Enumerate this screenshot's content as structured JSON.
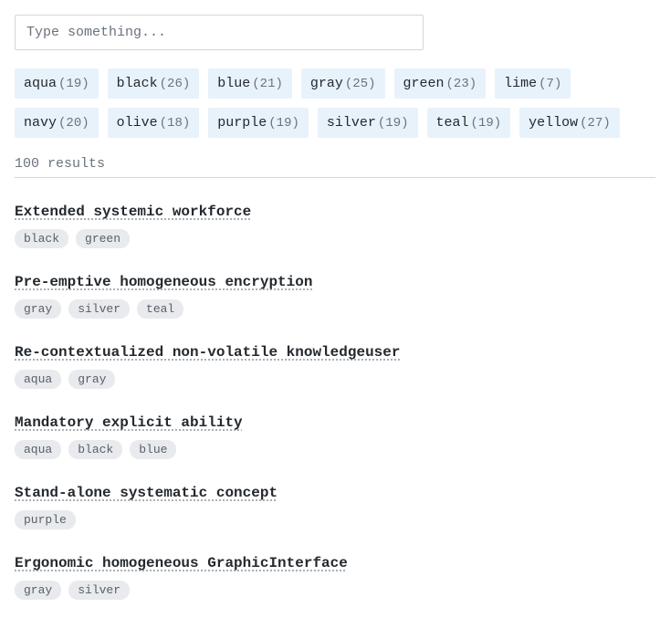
{
  "search": {
    "placeholder": "Type something..."
  },
  "filters": [
    {
      "name": "aqua",
      "count": 19
    },
    {
      "name": "black",
      "count": 26
    },
    {
      "name": "blue",
      "count": 21
    },
    {
      "name": "gray",
      "count": 25
    },
    {
      "name": "green",
      "count": 23
    },
    {
      "name": "lime",
      "count": 7
    },
    {
      "name": "navy",
      "count": 20
    },
    {
      "name": "olive",
      "count": 18
    },
    {
      "name": "purple",
      "count": 19
    },
    {
      "name": "silver",
      "count": 19
    },
    {
      "name": "teal",
      "count": 19
    },
    {
      "name": "yellow",
      "count": 27
    }
  ],
  "results_label": "100 results",
  "results": [
    {
      "title": "Extended systemic workforce",
      "tags": [
        "black",
        "green"
      ]
    },
    {
      "title": "Pre-emptive homogeneous encryption",
      "tags": [
        "gray",
        "silver",
        "teal"
      ]
    },
    {
      "title": "Re-contextualized non-volatile knowledgeuser",
      "tags": [
        "aqua",
        "gray"
      ]
    },
    {
      "title": "Mandatory explicit ability",
      "tags": [
        "aqua",
        "black",
        "blue"
      ]
    },
    {
      "title": "Stand-alone systematic concept",
      "tags": [
        "purple"
      ]
    },
    {
      "title": "Ergonomic homogeneous GraphicInterface",
      "tags": [
        "gray",
        "silver"
      ]
    }
  ]
}
